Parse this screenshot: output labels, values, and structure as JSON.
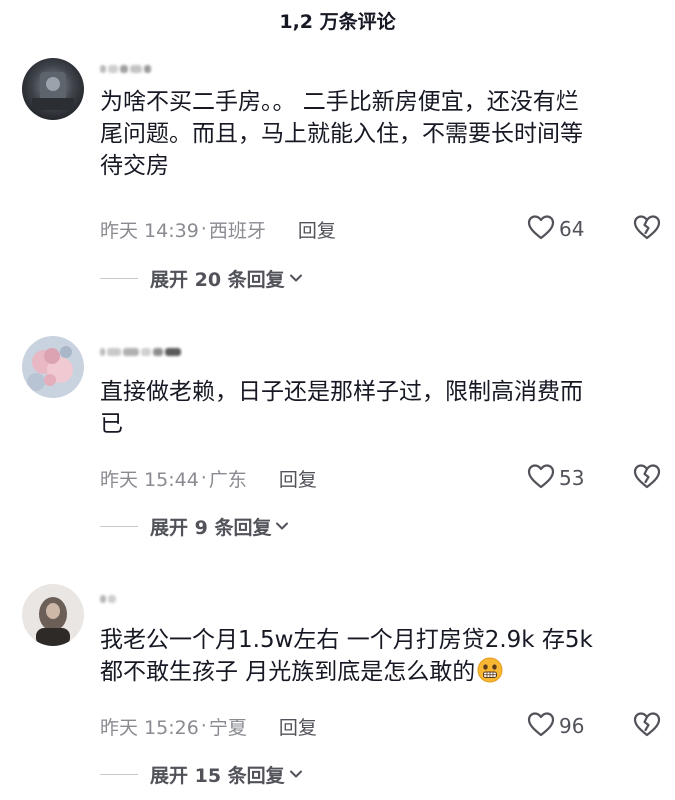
{
  "header": {
    "title": "1,2 万条评论"
  },
  "comments": [
    {
      "text_lines": [
        "为啥不买二手房。。 二手比新房便宜，还没有烂",
        "尾问题。而且，马上就能入住，不需要长时间等",
        "待交房"
      ],
      "time": "昨天 14:39",
      "location": "西班牙",
      "reply_label": "回复",
      "likes": "64",
      "expand_label": "展开 20 条回复"
    },
    {
      "text_lines": [
        "直接做老赖，日子还是那样子过，限制高消费而",
        "已"
      ],
      "time": "昨天 15:44",
      "location": "广东",
      "reply_label": "回复",
      "likes": "53",
      "expand_label": "展开 9 条回复"
    },
    {
      "text_lines": [
        "我老公一个月1.5w左右 一个月打房贷2.9k 存5k",
        "都不敢生孩子 月光族到底是怎么敢的"
      ],
      "emoji": "grimacing-face-icon",
      "time": "昨天 15:26",
      "location": "宁夏",
      "reply_label": "回复",
      "likes": "96",
      "expand_label": "展开 15 条回复"
    }
  ],
  "colors": {
    "primary_text": "#161823",
    "secondary_text": "#8a8b91",
    "action_text": "#52535a",
    "divider": "#c8c9cc"
  },
  "icons": {
    "like": "heart-outline-icon",
    "dislike": "broken-heart-icon",
    "expand": "chevron-down-icon"
  }
}
